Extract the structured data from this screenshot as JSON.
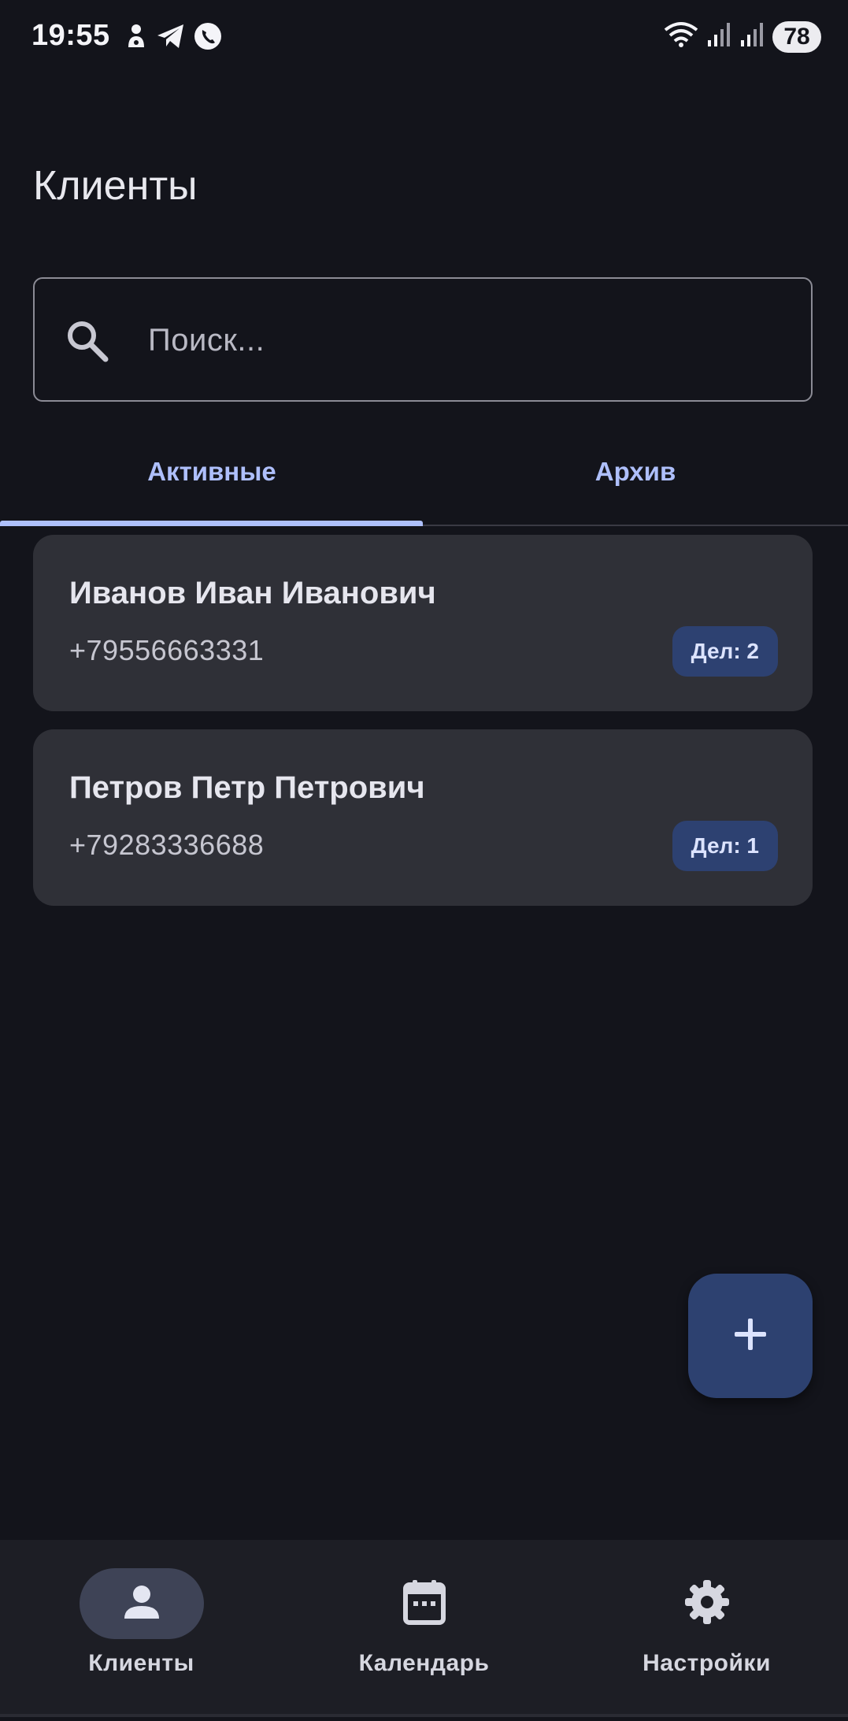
{
  "status_bar": {
    "time": "19:55",
    "battery": "78"
  },
  "page": {
    "title": "Клиенты"
  },
  "search": {
    "placeholder": "Поиск..."
  },
  "tabs": [
    {
      "label": "Активные",
      "selected": true
    },
    {
      "label": "Архив",
      "selected": false
    }
  ],
  "clients": [
    {
      "name": "Иванов Иван Иванович",
      "phone": "+79556663331",
      "badge": "Дел: 2"
    },
    {
      "name": "Петров Петр Петрович",
      "phone": "+79283336688",
      "badge": "Дел: 1"
    }
  ],
  "fab": {
    "icon": "plus-icon"
  },
  "bottom_nav": [
    {
      "label": "Клиенты",
      "icon": "person-icon",
      "active": true
    },
    {
      "label": "Календарь",
      "icon": "calendar-icon",
      "active": false
    },
    {
      "label": "Настройки",
      "icon": "gear-icon",
      "active": false
    }
  ],
  "colors": {
    "background": "#13141b",
    "card": "#2f3037",
    "accent": "#aec0fb",
    "badge": "#2d4171",
    "fab": "#2d4170",
    "nav_background": "#1d1e25"
  }
}
